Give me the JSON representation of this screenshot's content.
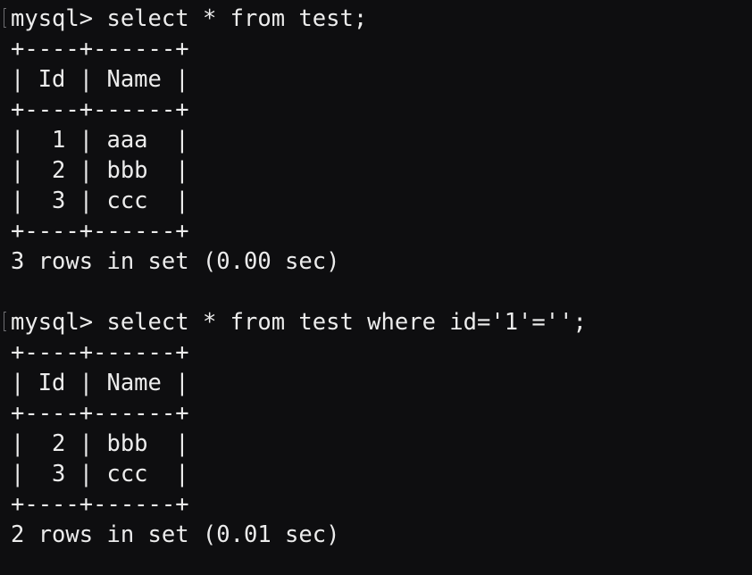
{
  "terminal": {
    "blocks": [
      {
        "prompt": "mysql>",
        "command": " select * from test;",
        "border": "+----+------+",
        "header": "| Id | Name |",
        "rows": [
          "|  1 | aaa  |",
          "|  2 | bbb  |",
          "|  3 | ccc  |"
        ],
        "status": "3 rows in set (0.00 sec)"
      },
      {
        "prompt": "mysql>",
        "command": " select * from test where id='1'='';",
        "border": "+----+------+",
        "header": "| Id | Name |",
        "rows": [
          "|  2 | bbb  |",
          "|  3 | ccc  |"
        ],
        "status": "2 rows in set (0.01 sec)"
      }
    ]
  },
  "colors": {
    "background": "#0e0e10",
    "text": "#ececec",
    "bracket": "#6e6e72"
  }
}
